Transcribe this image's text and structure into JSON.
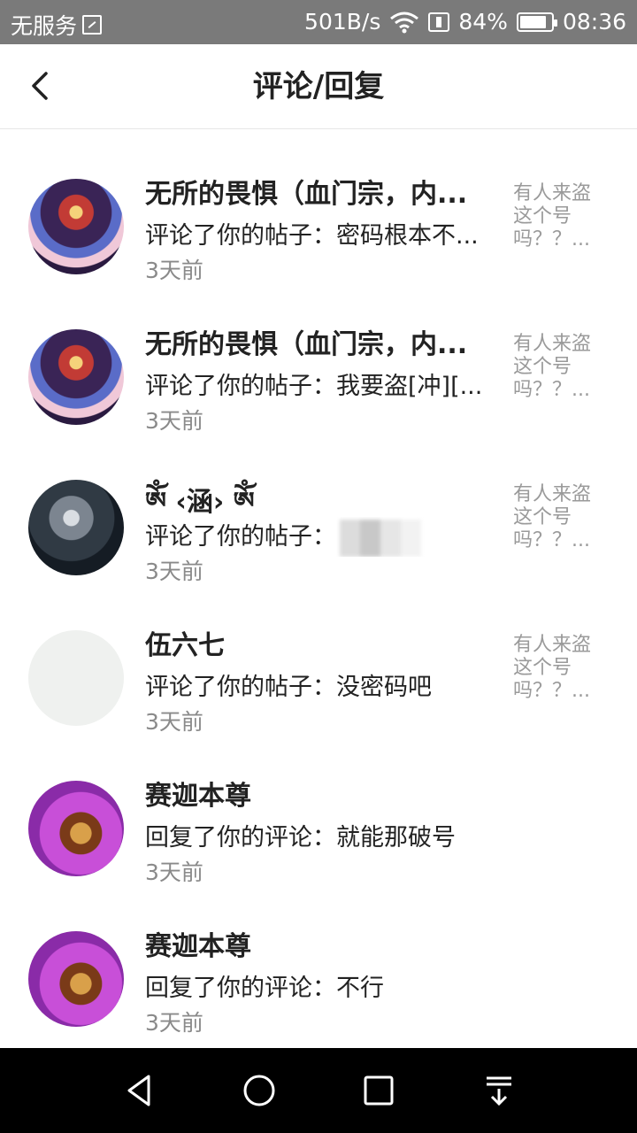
{
  "status_bar": {
    "carrier": "无服务",
    "speed": "501B/s",
    "battery_pct": "84%",
    "battery_level": 0.84,
    "time": "08:36",
    "icons": [
      "sim-icon",
      "wifi-icon",
      "data-icon",
      "battery-icon"
    ]
  },
  "header": {
    "title": "评论/回复",
    "back_icon": "chevron-left-icon"
  },
  "items": [
    {
      "name": "无所的畏惧（血门宗，内...",
      "desc": "评论了你的帖子：密码根本不...",
      "time": "3天前",
      "quote": "有人来盗\n这个号\n吗？？...",
      "avatar": "warrior"
    },
    {
      "name": "无所的畏惧（血门宗，内...",
      "desc": "评论了你的帖子：我要盗[冲][...",
      "time": "3天前",
      "quote": "有人来盗\n这个号\n吗？？...",
      "avatar": "warrior"
    },
    {
      "name": "ༀ ‹涵› ༀ",
      "desc": "评论了你的帖子：",
      "time": "3天前",
      "quote": "有人来盗\n这个号\n吗？？...",
      "avatar": "dark",
      "blurred_image": true
    },
    {
      "name": "伍六七",
      "desc": "评论了你的帖子：没密码吧",
      "time": "3天前",
      "quote": "有人来盗\n这个号\n吗？？...",
      "avatar": "blank"
    },
    {
      "name": "赛迦本尊",
      "desc": "回复了你的评论：就能那破号",
      "time": "3天前",
      "quote": "",
      "avatar": "purple"
    },
    {
      "name": "赛迦本尊",
      "desc": "回复了你的评论：不行",
      "time": "3天前",
      "quote": "",
      "avatar": "purple"
    }
  ],
  "nav_bar": {
    "icons": [
      "back-triangle-icon",
      "home-circle-icon",
      "recents-square-icon",
      "notification-pulldown-icon"
    ]
  }
}
